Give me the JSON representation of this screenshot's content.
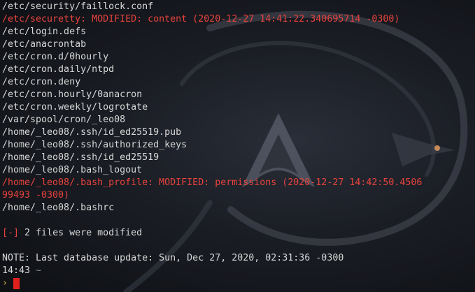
{
  "lines": [
    {
      "text": "/etc/security/faillock.conf",
      "type": "normal"
    },
    {
      "text": "/etc/securetty: MODIFIED: content (2020-12-27 14:41:22.340695714 -0300)",
      "type": "modified"
    },
    {
      "text": "/etc/login.defs",
      "type": "normal"
    },
    {
      "text": "/etc/anacrontab",
      "type": "normal"
    },
    {
      "text": "/etc/cron.d/0hourly",
      "type": "normal"
    },
    {
      "text": "/etc/cron.daily/ntpd",
      "type": "normal"
    },
    {
      "text": "/etc/cron.deny",
      "type": "normal"
    },
    {
      "text": "/etc/cron.hourly/0anacron",
      "type": "normal"
    },
    {
      "text": "/etc/cron.weekly/logrotate",
      "type": "normal"
    },
    {
      "text": "/var/spool/cron/_leo08",
      "type": "normal"
    },
    {
      "text": "/home/_leo08/.ssh/id_ed25519.pub",
      "type": "normal"
    },
    {
      "text": "/home/_leo08/.ssh/authorized_keys",
      "type": "normal"
    },
    {
      "text": "/home/_leo08/.ssh/id_ed25519",
      "type": "normal"
    },
    {
      "text": "/home/_leo08/.bash_logout",
      "type": "normal"
    },
    {
      "text": "/home/_leo08/.bash_profile: MODIFIED: permissions (2020-12-27 14:42:50.4506",
      "type": "modified"
    },
    {
      "text": "99493 -0300)",
      "type": "modified"
    },
    {
      "text": "/home/_leo08/.bashrc",
      "type": "normal"
    }
  ],
  "summary": {
    "tag": "[-]",
    "text": " 2 files were modified"
  },
  "note": "NOTE: Last database update: Sun, Dec 27, 2020, 02:31:36 -0300",
  "prompt": {
    "time": "14:43",
    "dir": "~",
    "chevron": "›"
  },
  "colors": {
    "background": "#111318",
    "text": "#d7d7d7",
    "modified": "#e8433d",
    "chevron": "#c9b14a",
    "cursor": "#e1201e"
  },
  "wallpaper": {
    "icon": "arch-linux-logo-icon"
  }
}
